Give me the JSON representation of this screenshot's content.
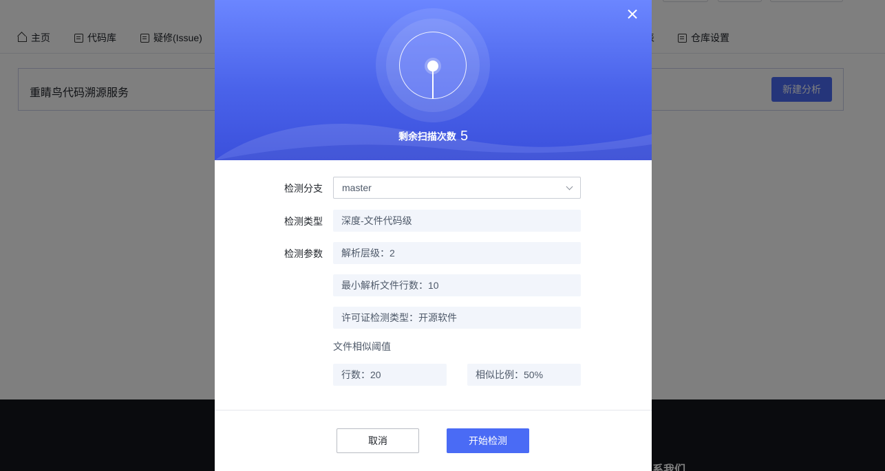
{
  "nav": {
    "home": "主页",
    "repo": "代码库",
    "issue": "疑修(Issue)",
    "partial": "表",
    "settings": "仓库设置"
  },
  "banner": {
    "title": "重睛鸟代码溯源服务",
    "new_button": "新建分析"
  },
  "footer": {
    "contact": "系我们"
  },
  "modal": {
    "remaining_label": "剩余扫描次数",
    "remaining_count": "5",
    "branch_label": "检测分支",
    "branch_value": "master",
    "type_label": "检测类型",
    "type_value": "深度-文件代码级",
    "params_label": "检测参数",
    "param_depth": "解析层级：2",
    "param_min_lines": "最小解析文件行数：10",
    "param_license": "许可证检测类型：开源软件",
    "threshold_label": "文件相似阈值",
    "threshold_lines": "行数：20",
    "threshold_ratio": "相似比例：50%",
    "cancel_button": "取消",
    "start_button": "开始检测"
  },
  "colors": {
    "accent": "#4a6bf5",
    "hero_top": "#6b86ff",
    "hero_bottom": "#3b50dc"
  }
}
